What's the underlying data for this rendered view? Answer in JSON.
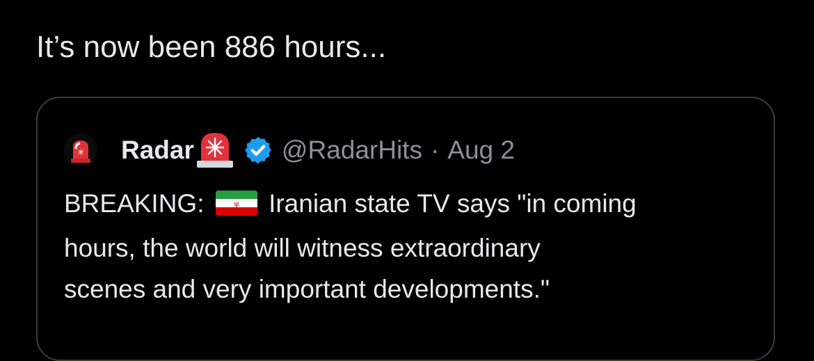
{
  "tweet": {
    "text": "It’s now been 886 hours..."
  },
  "quoted_tweet": {
    "display_name": "Radar",
    "name_emoji": "rotating-light-icon",
    "verified_badge": "verified-badge-icon",
    "handle": "@RadarHits",
    "separator": "·",
    "date": "Aug 2",
    "body_prefix": "BREAKING:",
    "body_flag": "iran-flag-icon",
    "body_rest_line1": "Iranian state TV says \"in coming",
    "body_line2": "hours, the world will witness extraordinary",
    "body_line3": "scenes and very important developments.\""
  },
  "colors": {
    "background": "#000000",
    "text_primary": "#e7e9ea",
    "text_secondary": "#8b9298",
    "card_border": "#3a3d41",
    "verified_blue": "#1d9bf0",
    "alarm_red": "#e0323a"
  }
}
